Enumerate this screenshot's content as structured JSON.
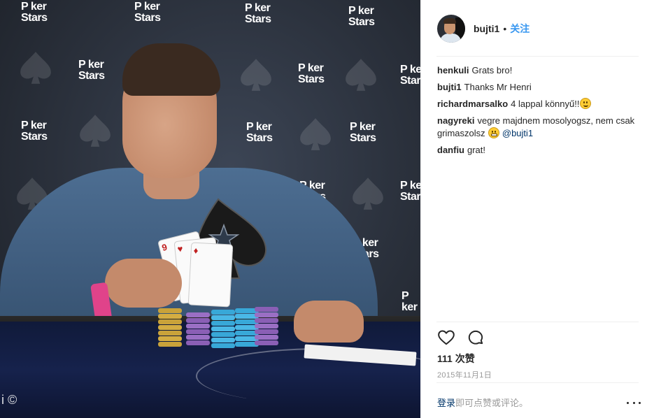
{
  "photo": {
    "backdrop_logo_line1": "P ker",
    "backdrop_logo_line2": "Stars",
    "card_rank": "9",
    "watermark": "i ©"
  },
  "post": {
    "author": {
      "username": "bujti1",
      "separator": "•",
      "follow_label": "关注",
      "avatar_icon": "avatar-photo"
    },
    "comments": [
      {
        "user": "henkuli",
        "text": "Grats bro!"
      },
      {
        "user": "bujti1",
        "text": "Thanks Mr Henri"
      },
      {
        "user": "richardmarsalko",
        "text": "4 lappal könnyű!!"
      },
      {
        "user": "nagyreki",
        "text": "vegre majdnem mosolyogsz, nem csak grimaszolsz",
        "mention": "@bujti1"
      },
      {
        "user": "danfiu",
        "text": "grat!"
      }
    ],
    "actions": {
      "like_icon": "heart-icon",
      "comment_icon": "comment-icon"
    },
    "likes_label": "111 次赞",
    "date": "2015年11月1日",
    "login_prompt": {
      "link": "登录",
      "rest": "即可点赞或评论。"
    },
    "more_icon": "more-options-icon"
  },
  "colors": {
    "follow_blue": "#3897f0",
    "mention_blue": "#003569",
    "divider": "#efefef",
    "muted_text": "#999999"
  }
}
